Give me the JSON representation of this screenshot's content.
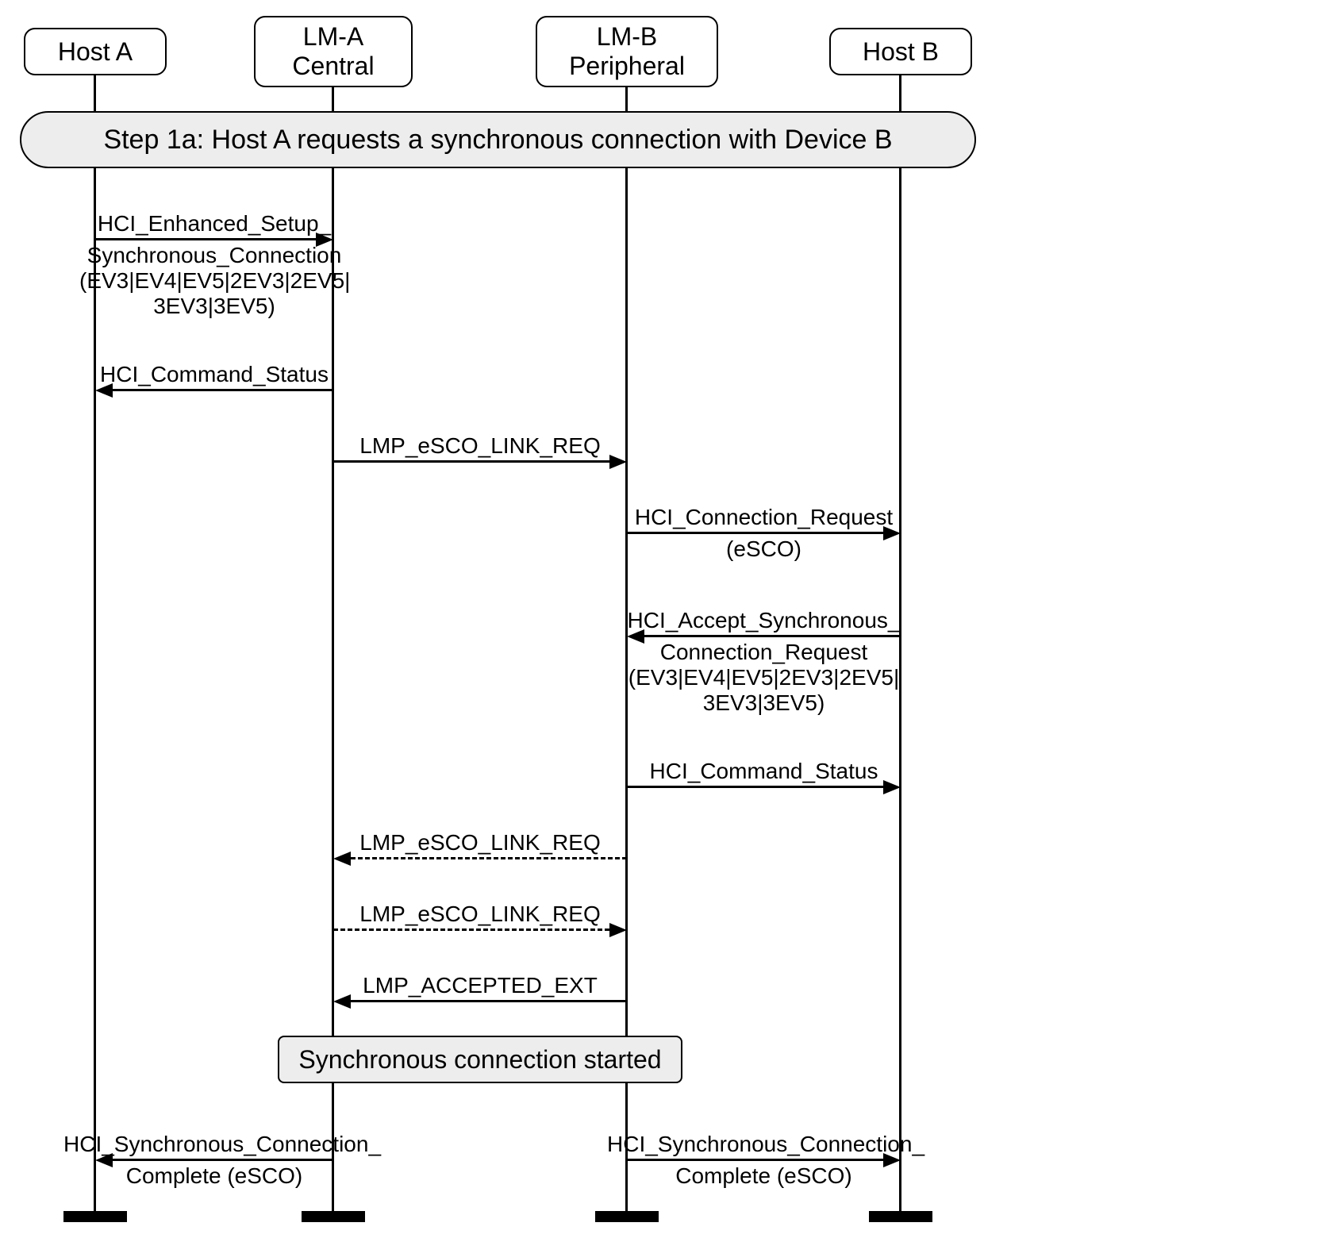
{
  "lifelines": {
    "hostA": {
      "label": "Host A"
    },
    "lmA": {
      "line1": "LM-A",
      "line2": "Central"
    },
    "lmB": {
      "line1": "LM-B",
      "line2": "Peripheral"
    },
    "hostB": {
      "label": "Host B"
    }
  },
  "step": {
    "text": "Step 1a:  Host A requests a synchronous connection with Device B"
  },
  "note": {
    "text": "Synchronous connection started"
  },
  "messages": {
    "m1": {
      "line1": "HCI_Enhanced_Setup_",
      "line2": "Synchronous_Connection",
      "line3": "(EV3|EV4|EV5|2EV3|2EV5|",
      "line4": "3EV3|3EV5)"
    },
    "m2": {
      "line1": "HCI_Command_Status"
    },
    "m3": {
      "line1": "LMP_eSCO_LINK_REQ"
    },
    "m4": {
      "line1": "HCI_Connection_Request",
      "line2": "(eSCO)"
    },
    "m5": {
      "line1": "HCI_Accept_Synchronous_",
      "line2": "Connection_Request",
      "line3": "(EV3|EV4|EV5|2EV3|2EV5|",
      "line4": "3EV3|3EV5)"
    },
    "m6": {
      "line1": "HCI_Command_Status"
    },
    "m7": {
      "line1": "LMP_eSCO_LINK_REQ"
    },
    "m8": {
      "line1": "LMP_eSCO_LINK_REQ"
    },
    "m9": {
      "line1": "LMP_ACCEPTED_EXT"
    },
    "m10": {
      "line1": "HCI_Synchronous_Connection_",
      "line2": "Complete (eSCO)"
    },
    "m11": {
      "line1": "HCI_Synchronous_Connection_",
      "line2": "Complete (eSCO)"
    }
  }
}
